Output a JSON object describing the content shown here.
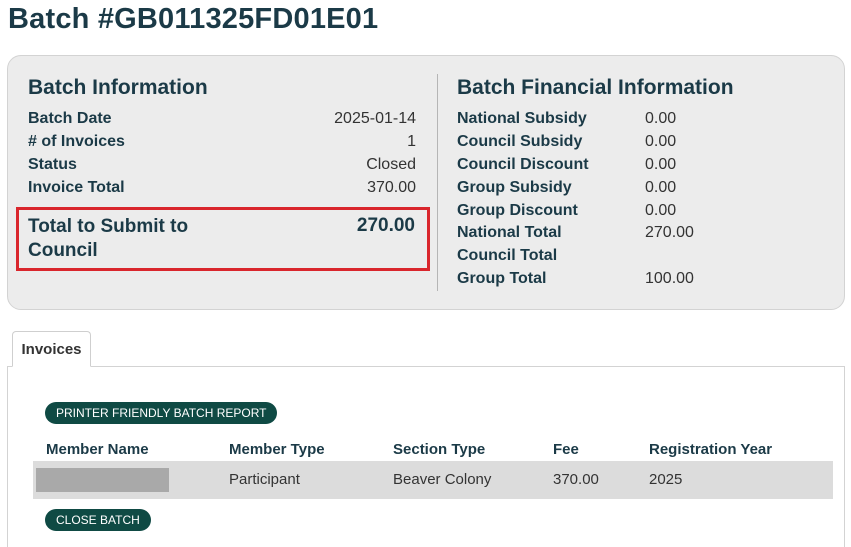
{
  "page_title": "Batch #GB011325FD01E01",
  "batch_info": {
    "heading": "Batch Information",
    "rows": [
      {
        "label": "Batch Date",
        "value": "2025-01-14"
      },
      {
        "label": "# of Invoices",
        "value": "1"
      },
      {
        "label": "Status",
        "value": "Closed"
      },
      {
        "label": "Invoice Total",
        "value": "370.00"
      }
    ],
    "total_submit": {
      "label": "Total to Submit to Council",
      "value": "270.00"
    }
  },
  "financial_info": {
    "heading": "Batch Financial Information",
    "rows": [
      {
        "label": "National Subsidy",
        "value": "0.00"
      },
      {
        "label": "Council Subsidy",
        "value": "0.00"
      },
      {
        "label": "Council Discount",
        "value": "0.00"
      },
      {
        "label": "Group Subsidy",
        "value": "0.00"
      },
      {
        "label": "Group Discount",
        "value": "0.00"
      },
      {
        "label": "National Total",
        "value": "270.00"
      },
      {
        "label": "Council Total",
        "value": ""
      },
      {
        "label": "Group Total",
        "value": "100.00"
      }
    ]
  },
  "tabs": {
    "invoices_label": "Invoices"
  },
  "buttons": {
    "printer_report": "PRINTER FRIENDLY BATCH REPORT",
    "close_batch": "CLOSE BATCH"
  },
  "table": {
    "headers": [
      "Member Name",
      "Member Type",
      "Section Type",
      "Fee",
      "Registration Year"
    ],
    "rows": [
      {
        "member_name": "",
        "member_type": "Participant",
        "section_type": "Beaver Colony",
        "fee": "370.00",
        "registration_year": "2025"
      }
    ]
  },
  "colors": {
    "accent": "#0f4a44",
    "highlight": "#d9262c",
    "heading": "#1b3a47"
  }
}
